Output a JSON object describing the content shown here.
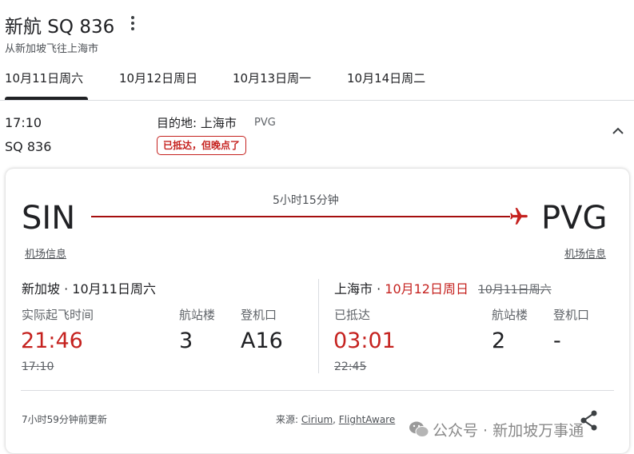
{
  "header": {
    "title": "新航 SQ 836",
    "subtitle": "从新加坡飞往上海市"
  },
  "tabs": [
    {
      "label": "10月11日周六",
      "selected": true
    },
    {
      "label": "10月12日周日",
      "selected": false
    },
    {
      "label": "10月13日周一",
      "selected": false
    },
    {
      "label": "10月14日周二",
      "selected": false
    }
  ],
  "summary": {
    "time": "17:10",
    "flight": "SQ 836",
    "dest_label": "目的地: 上海市",
    "dest_code": "PVG",
    "status": "已抵达，但晚点了"
  },
  "card": {
    "origin_code": "SIN",
    "dest_code": "PVG",
    "duration": "5小时15分钟",
    "origin_link": "机场信息",
    "dest_link": "机场信息",
    "departure": {
      "city": "新加坡 · 10月11日周六",
      "time_label": "实际起飞时间",
      "time": "21:46",
      "scheduled": "17:10",
      "terminal_label": "航站楼",
      "terminal": "3",
      "gate_label": "登机口",
      "gate": "A16"
    },
    "arrival": {
      "city_prefix": "上海市 · ",
      "date": "10月12日周日",
      "original_date": "10月11日周六",
      "time_label": "已抵达",
      "time": "03:01",
      "scheduled": "22:45",
      "terminal_label": "航站楼",
      "terminal": "2",
      "gate_label": "登机口",
      "gate": "-"
    },
    "updated": "7小时59分钟前更新",
    "source_label": "来源: ",
    "source_1": "Cirium",
    "source_sep": ", ",
    "source_2": "FlightAware"
  },
  "watermark": "公众号 · 新加坡万事通",
  "icons": {
    "more": "more-vert-icon",
    "collapse": "chevron-up-icon",
    "plane": "airplane-icon",
    "share": "share-icon",
    "wechat": "wechat-icon"
  },
  "colors": {
    "accent_red": "#c5221f",
    "route_red": "#a50e0e",
    "text": "#202124"
  }
}
